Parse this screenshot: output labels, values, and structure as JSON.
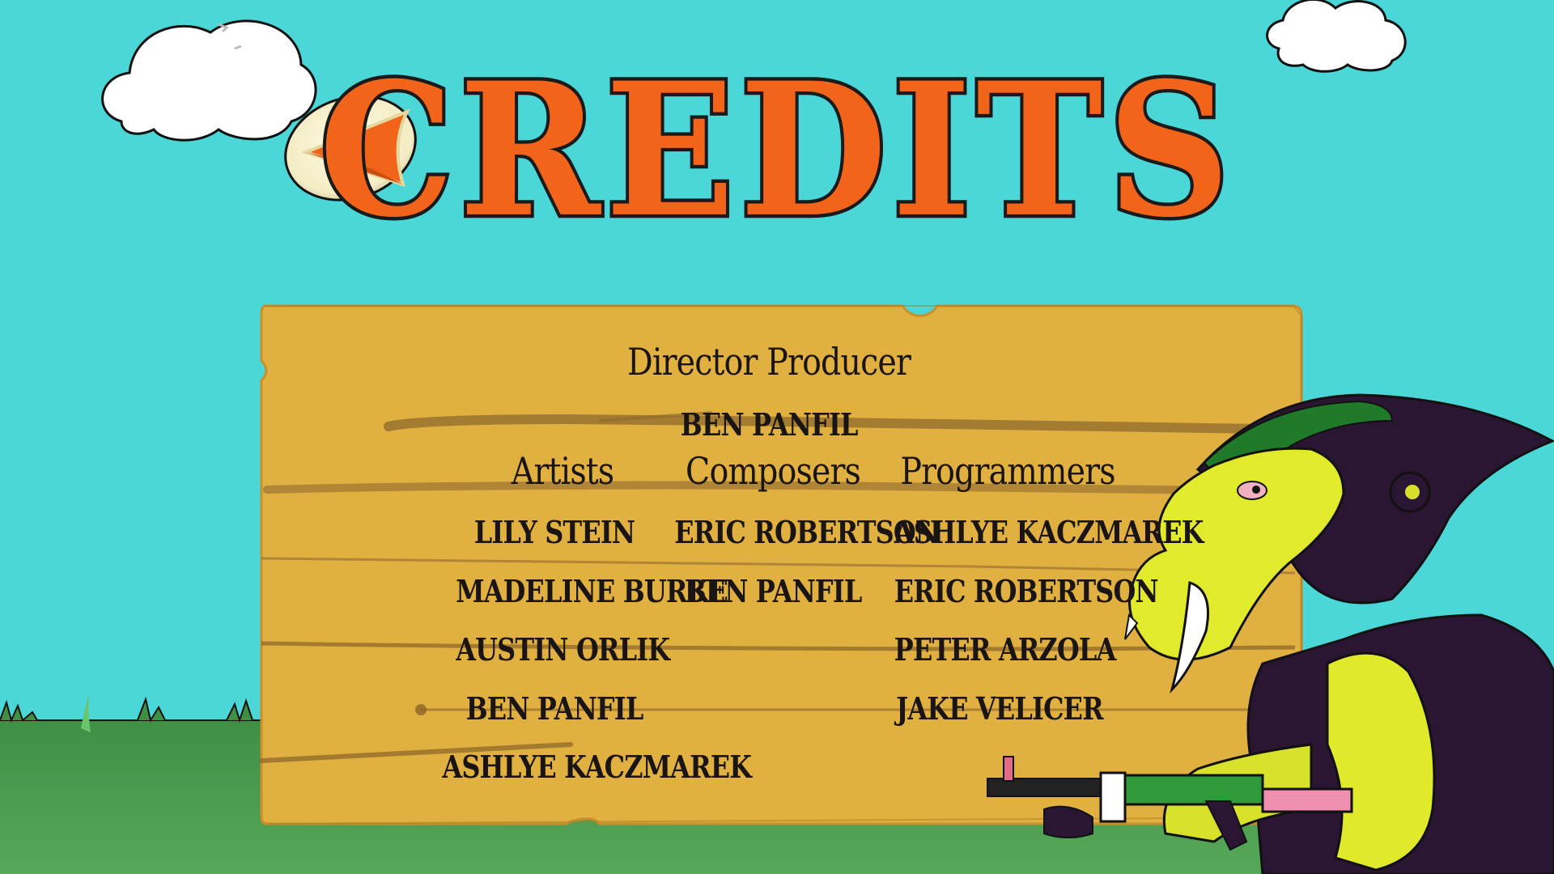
{
  "screen": {
    "title": "CREDITS"
  },
  "back_button": {
    "icon": "arrow-left-icon"
  },
  "credits": {
    "director_heading": "Director Producer",
    "director_name": "BEN PANFIL",
    "columns": [
      {
        "heading": "Artists",
        "names": [
          "LILY STEIN",
          "MADELINE BURKE",
          "AUSTIN ORLIK",
          "BEN PANFIL",
          "ASHLYE KACZMAREK"
        ]
      },
      {
        "heading": "Composers",
        "names": [
          "ERIC ROBERTSON",
          "BEN PANFIL"
        ]
      },
      {
        "heading": "Programmers",
        "names": [
          "ASHLYE KACZMAREK",
          "ERIC ROBERTSON",
          "PETER ARZOLA",
          "JAKE VELICER"
        ]
      }
    ]
  },
  "colors": {
    "sky": "#4bd6d8",
    "grass": "#4a9a4a",
    "board": "#e0b040",
    "title": "#f26419",
    "arrow": "#f26419"
  }
}
